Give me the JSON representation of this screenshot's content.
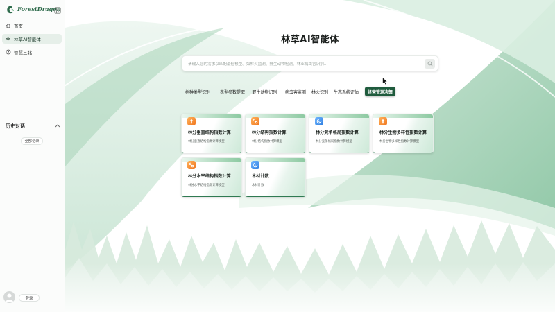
{
  "brand": {
    "name": "ForestDragon",
    "logo_icon": "dragon-leaf-logo"
  },
  "sidebar": {
    "nav": [
      {
        "label": "首页",
        "icon": "home-icon",
        "active": false
      },
      {
        "label": "林草AI智能体",
        "icon": "sparkle-icon",
        "active": true
      },
      {
        "label": "智慧三北",
        "icon": "compass-icon",
        "active": false
      }
    ],
    "history": {
      "title": "历史对话",
      "all_records_label": "全部记录"
    },
    "login_label": "登录"
  },
  "main": {
    "title": "林草AI智能体",
    "search": {
      "placeholder": "请输入您的需求以匹配最佳模型。如林火监测、野生动物检测、林业病虫害识别...",
      "value": ""
    },
    "tabs": [
      {
        "label": "树种类型识别",
        "active": false
      },
      {
        "label": "表型参数提取",
        "active": false
      },
      {
        "label": "野生动物识别",
        "active": false
      },
      {
        "label": "病虫害监测",
        "active": false
      },
      {
        "label": "林火识别",
        "active": false
      },
      {
        "label": "生态系统评估",
        "active": false
      },
      {
        "label": "经营管理决策",
        "active": true
      }
    ],
    "cards": [
      {
        "title": "林分垂直结构指数计算",
        "desc": "林分垂直结构指数计算模型",
        "icon": "tree-icon",
        "icon_color": "orange"
      },
      {
        "title": "林分结构指数计算",
        "desc": "林分结构指数计算模型",
        "icon": "network-icon",
        "icon_color": "orange"
      },
      {
        "title": "林分竞争格局指数计算",
        "desc": "林分竞争格局指数计算模型",
        "icon": "swirl-icon",
        "icon_color": "blue"
      },
      {
        "title": "林分生物多样性指数计算",
        "desc": "林分生物多样性指数计算模型",
        "icon": "tree-icon",
        "icon_color": "orange"
      },
      {
        "title": "林分水平结构指数计算",
        "desc": "林分水平结构指数计算模型",
        "icon": "network-icon",
        "icon_color": "orange"
      },
      {
        "title": "木材计数",
        "desc": "木材计数",
        "icon": "swirl-icon",
        "icon_color": "blue"
      }
    ]
  },
  "colors": {
    "accent": "#1f5b3d",
    "brand": "#2d6a4a",
    "card_icon_orange": "#f0761f",
    "card_icon_blue": "#2e7ee0"
  }
}
